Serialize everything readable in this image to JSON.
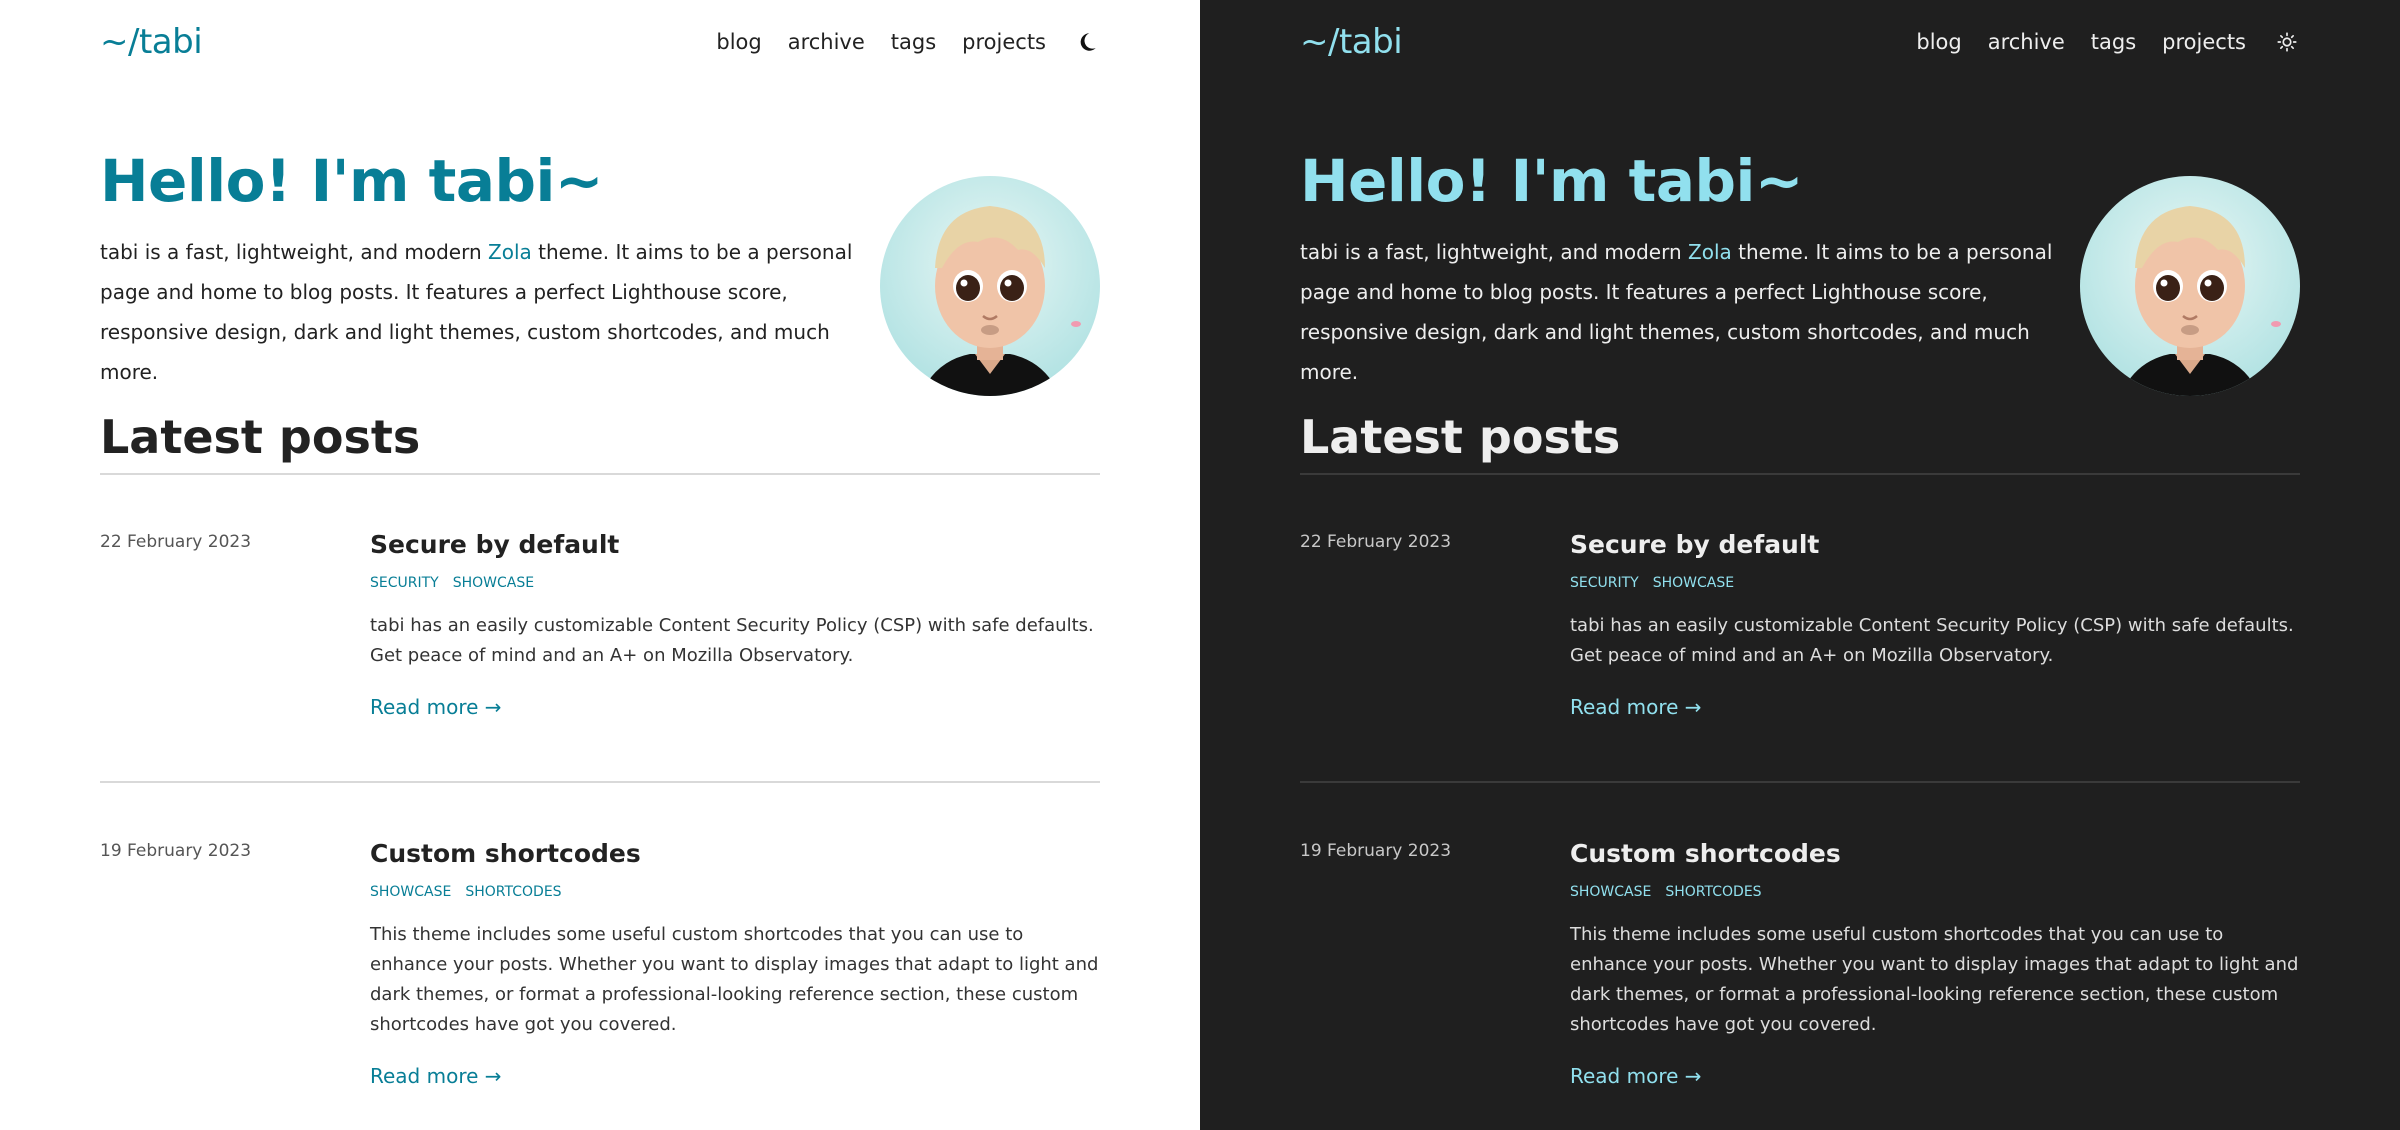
{
  "site": {
    "logo": "~/tabi",
    "nav": [
      "blog",
      "archive",
      "tags",
      "projects"
    ]
  },
  "hero": {
    "title": "Hello! I'm tabi~",
    "intro_before": "tabi is a fast, lightweight, and modern ",
    "intro_link": "Zola",
    "intro_after": " theme. It aims to be a personal page and home to blog posts. It features a perfect Lighthouse score, responsive design, dark and light themes, custom shortcodes, and much more."
  },
  "latest": {
    "heading": "Latest posts",
    "read_more": "Read more →",
    "posts": [
      {
        "date": "22 February 2023",
        "title": "Secure by default",
        "tags": [
          "SECURITY",
          "SHOWCASE"
        ],
        "summary": "tabi has an easily customizable Content Security Policy (CSP) with safe defaults. Get peace of mind and an A+ on Mozilla Observatory."
      },
      {
        "date": "19 February 2023",
        "title": "Custom shortcodes",
        "tags": [
          "SHOWCASE",
          "SHORTCODES"
        ],
        "summary": "This theme includes some useful custom shortcodes that you can use to enhance your posts. Whether you want to display images that adapt to light and dark themes, or format a professional-looking reference section, these custom shortcodes have got you covered."
      }
    ]
  },
  "themes": {
    "light": {
      "icon": "moon-icon",
      "accent": "#087e96",
      "background": "#ffffff"
    },
    "dark": {
      "icon": "sun-icon",
      "accent": "#91e0ee",
      "background": "#1f1f1f"
    }
  }
}
